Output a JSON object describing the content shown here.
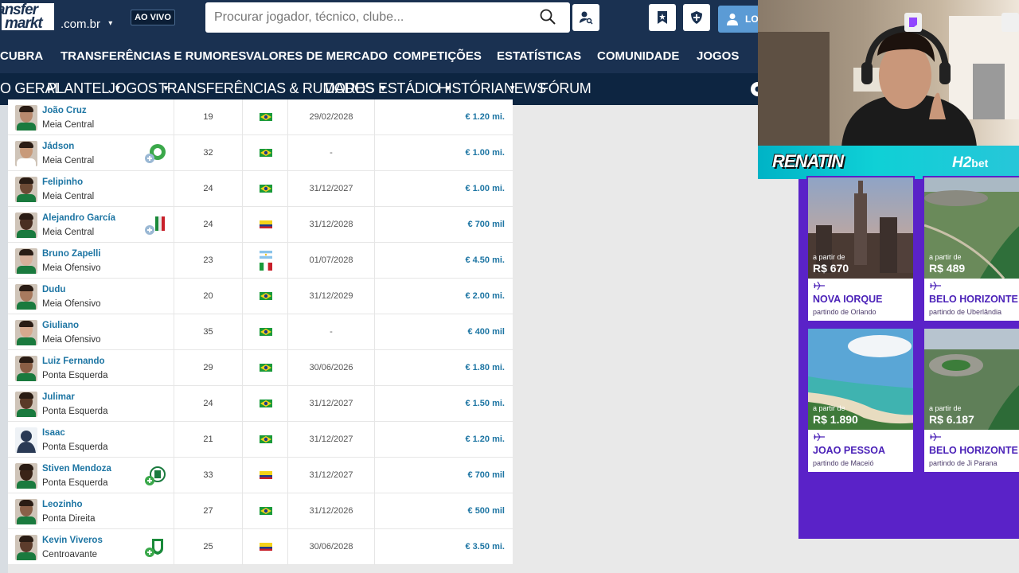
{
  "header": {
    "logo_line1": "ansfer",
    "logo_line2": "markt",
    "domain": ".com.br",
    "live_label": "AO VIVO",
    "search_placeholder": "Procurar jogador, técnico, clube...",
    "login_label": "LO"
  },
  "nav_main": [
    "CUBRA",
    "TRANSFERÊNCIAS E RUMORES",
    "VALORES DE MERCADO",
    "COMPETIÇÕES",
    "ESTATÍSTICAS",
    "COMUNIDADE",
    "JOGOS"
  ],
  "nav_sub": [
    "O GERAL",
    "PLANTEL",
    "JOGOS",
    "TRANSFERÊNCIAS & RUMORES",
    "DADOS",
    "ESTÁDIO",
    "HISTÓRIA",
    "NEWS",
    "FÓRUM"
  ],
  "players": [
    {
      "name": "João Cruz",
      "position": "Meia Central",
      "age": "19",
      "nat": "brazil",
      "contract": "29/02/2028",
      "value": "€ 1.20 mi."
    },
    {
      "name": "Jádson",
      "position": "Meia Central",
      "age": "32",
      "nat": "brazil",
      "contract": "-",
      "value": "€ 1.00 mi."
    },
    {
      "name": "Felipinho",
      "position": "Meia Central",
      "age": "24",
      "nat": "brazil",
      "contract": "31/12/2027",
      "value": "€ 1.00 mi."
    },
    {
      "name": "Alejandro García",
      "position": "Meia Central",
      "age": "24",
      "nat": "colombia",
      "contract": "31/12/2028",
      "value": "€ 700 mil"
    },
    {
      "name": "Bruno Zapelli",
      "position": "Meia Ofensivo",
      "age": "23",
      "nat": "argentina-italy",
      "contract": "01/07/2028",
      "value": "€ 4.50 mi."
    },
    {
      "name": "Dudu",
      "position": "Meia Ofensivo",
      "age": "20",
      "nat": "brazil",
      "contract": "31/12/2029",
      "value": "€ 2.00 mi."
    },
    {
      "name": "Giuliano",
      "position": "Meia Ofensivo",
      "age": "35",
      "nat": "brazil",
      "contract": "-",
      "value": "€ 400 mil"
    },
    {
      "name": "Luiz Fernando",
      "position": "Ponta Esquerda",
      "age": "29",
      "nat": "brazil",
      "contract": "30/06/2026",
      "value": "€ 1.80 mi."
    },
    {
      "name": "Julimar",
      "position": "Ponta Esquerda",
      "age": "24",
      "nat": "brazil",
      "contract": "31/12/2027",
      "value": "€ 1.50 mi."
    },
    {
      "name": "Isaac",
      "position": "Ponta Esquerda",
      "age": "21",
      "nat": "brazil",
      "contract": "31/12/2027",
      "value": "€ 1.20 mi."
    },
    {
      "name": "Stiven Mendoza",
      "position": "Ponta Esquerda",
      "age": "33",
      "nat": "colombia",
      "contract": "31/12/2027",
      "value": "€ 700 mil"
    },
    {
      "name": "Leozinho",
      "position": "Ponta Direita",
      "age": "27",
      "nat": "brazil",
      "contract": "31/12/2026",
      "value": "€ 500 mil"
    },
    {
      "name": "Kevin Viveros",
      "position": "Centroavante",
      "age": "25",
      "nat": "colombia",
      "contract": "30/06/2028",
      "value": "€ 3.50 mi."
    }
  ],
  "stream": {
    "streamer_brand": "RENATIN",
    "sponsor_main": "H2",
    "sponsor_sub": "bet"
  },
  "ads": [
    {
      "from_label": "a partir de",
      "price": "R$ 670",
      "city": "NOVA IORQUE",
      "origin": "partindo de Orlando"
    },
    {
      "from_label": "a partir de",
      "price": "R$ 489",
      "city": "BELO HORIZONTE",
      "origin": "partindo de Uberlândia"
    },
    {
      "from_label": "a partir de",
      "price": "R$ 1.890",
      "city": "JOAO PESSOA",
      "origin": "partindo de Maceió"
    },
    {
      "from_label": "a partir de",
      "price": "R$ 6.187",
      "city": "BELO HORIZONTE",
      "origin": "partindo de Ji Parana"
    }
  ],
  "colors": {
    "navy": "#1a3151",
    "link": "#1d75a3",
    "ad_purple": "#5a22c8",
    "banner_cyan": "#0fd0d6"
  }
}
